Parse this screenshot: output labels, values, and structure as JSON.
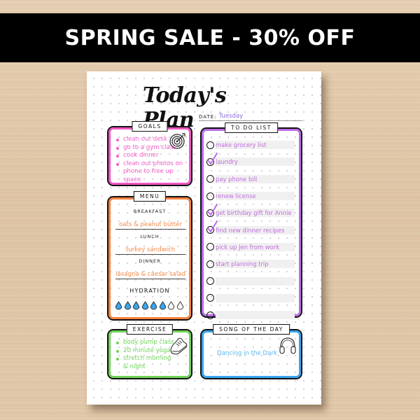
{
  "banner": {
    "text": "SPRING SALE - 30% OFF"
  },
  "planner": {
    "title": "Today's Plan",
    "date_label": "DATE:",
    "date_value": "Tuesday",
    "goals": {
      "label": "GOALS",
      "icon": "target-icon",
      "color": "#ee57c2",
      "items": [
        "clean out desk",
        "go to a gym class",
        "cook dinner",
        "clean out photos on phone to free up space"
      ]
    },
    "menu": {
      "label": "MENU",
      "color": "#f5823e",
      "breakfast_label": "BREAKFAST",
      "breakfast": "oats & peanut butter",
      "lunch_label": "LUNCH",
      "lunch": "turkey sandwich",
      "dinner_label": "DINNER",
      "dinner": "lasagna & caesar salad",
      "hydration_label": "HYDRATION",
      "hydration_filled": 6,
      "hydration_total": 8,
      "drop_color": "#3aa5ee"
    },
    "exercise": {
      "label": "EXERCISE",
      "icon": "sneaker-icon",
      "color": "#6fd357",
      "items": [
        "body pump class",
        "20 minute yoga",
        "stretch morning & night"
      ]
    },
    "todo": {
      "label": "TO DO LIST",
      "color": "#b96ce6",
      "items": [
        {
          "text": "make grocery list",
          "done": false
        },
        {
          "text": "laundry",
          "done": true
        },
        {
          "text": "pay phone bill",
          "done": false
        },
        {
          "text": "renew license",
          "done": false
        },
        {
          "text": "get birthday gift for Annie",
          "done": true
        },
        {
          "text": "find new dinner recipes",
          "done": true
        },
        {
          "text": "pick up Jen from work",
          "done": false
        },
        {
          "text": "start planning trip",
          "done": false
        },
        {
          "text": "",
          "done": false
        },
        {
          "text": "",
          "done": false
        },
        {
          "text": "",
          "done": false
        }
      ]
    },
    "song": {
      "label": "SONG OF THE DAY",
      "icon": "headphones-icon",
      "color": "#3aa5ee",
      "title": "Dancing in the Dark"
    }
  }
}
